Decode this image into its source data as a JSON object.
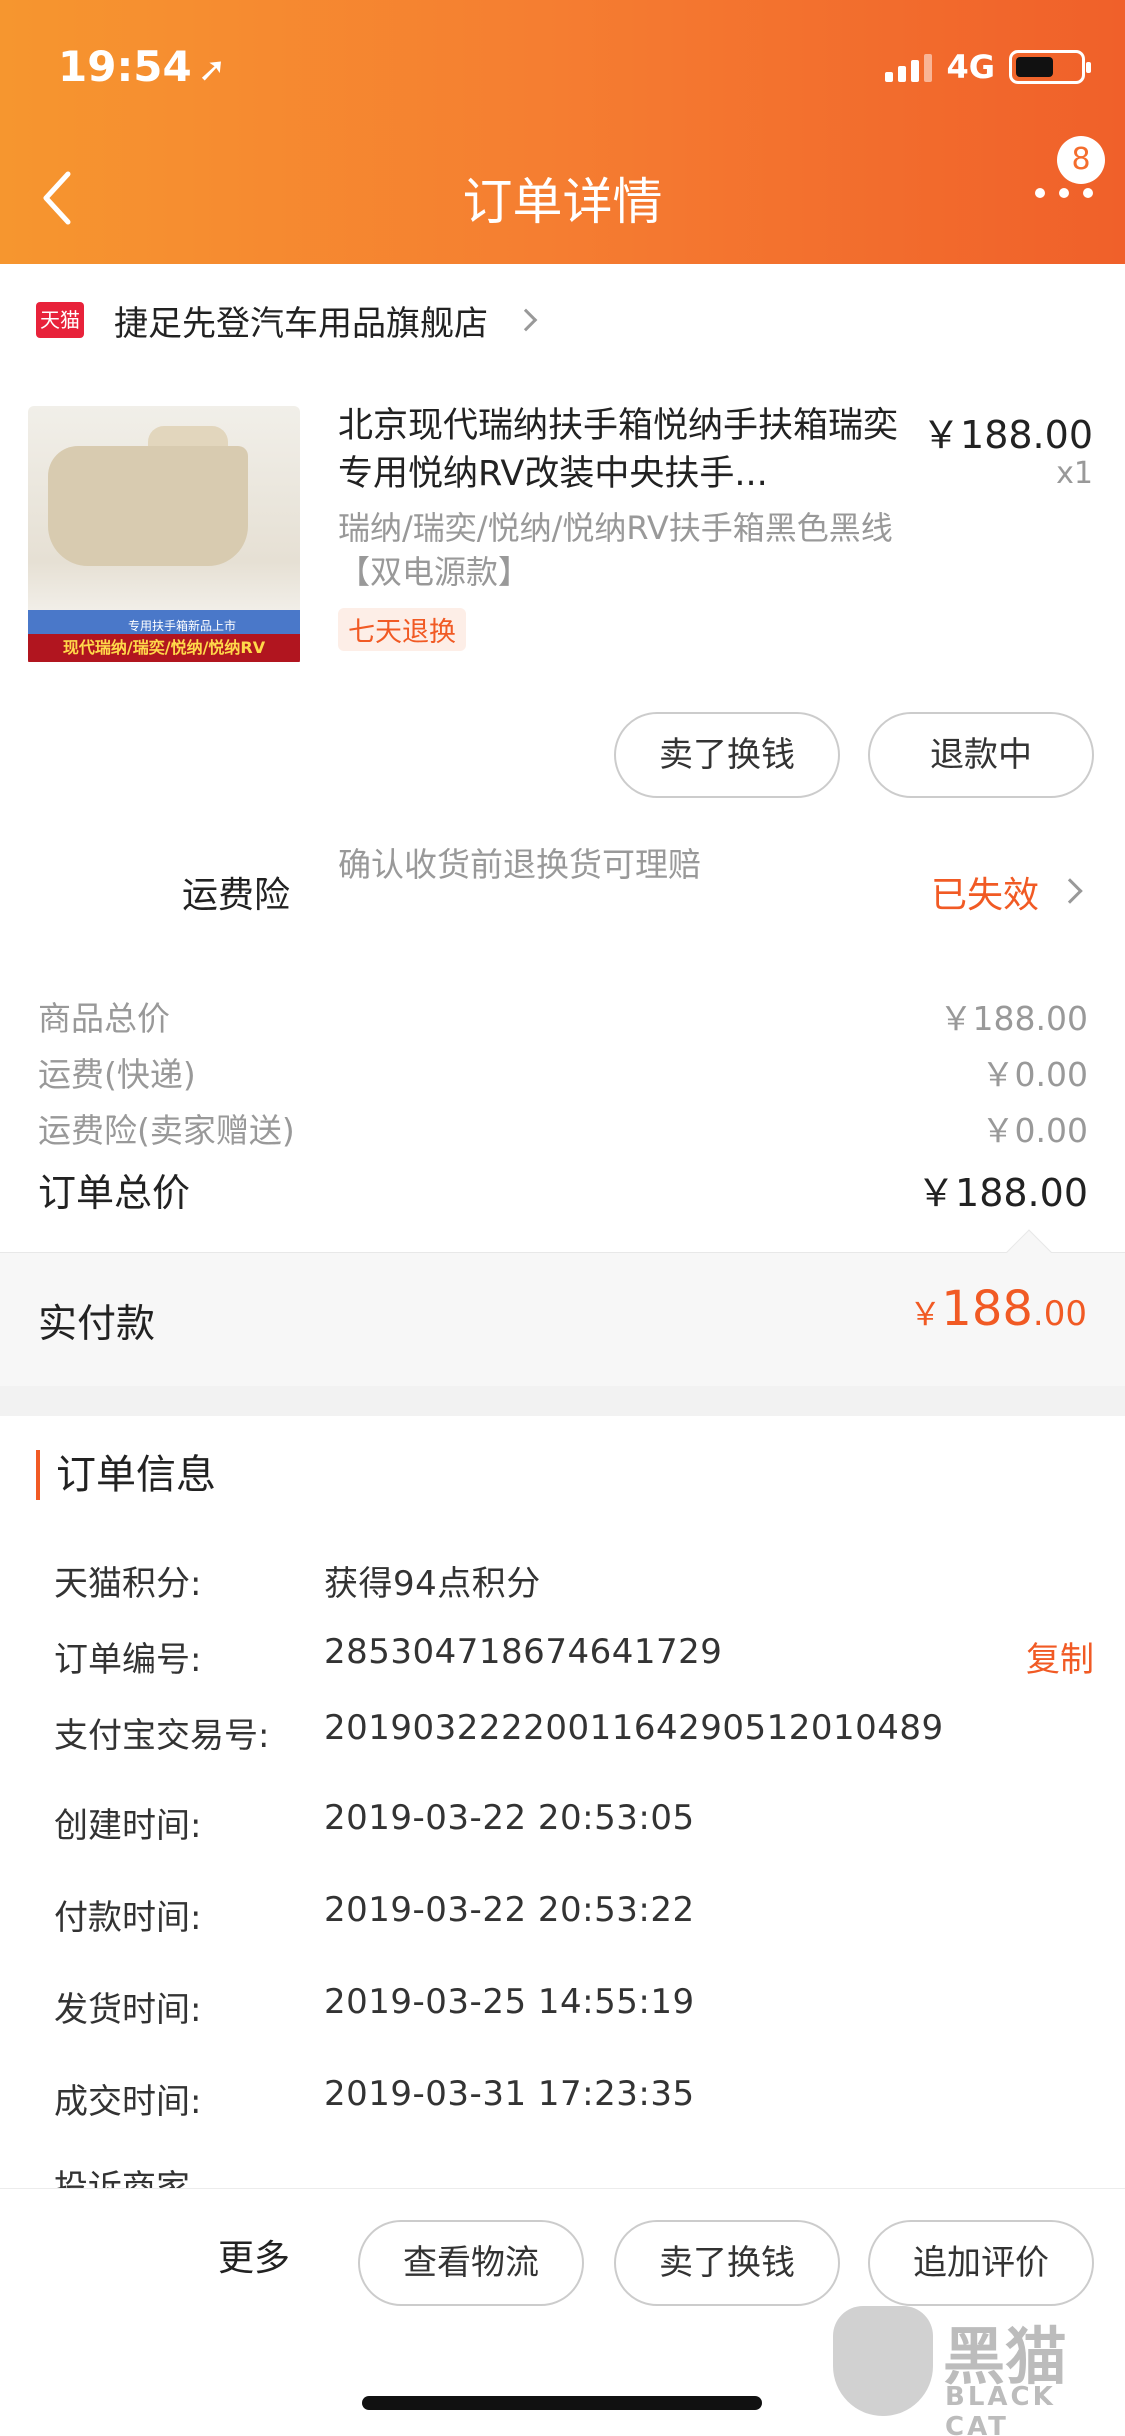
{
  "status_bar": {
    "time": "19:54",
    "network": "4G"
  },
  "nav": {
    "title": "订单详情",
    "badge_count": "8"
  },
  "store": {
    "logo_text": "天猫",
    "name": "捷足先登汽车用品旗舰店"
  },
  "product": {
    "title": "北京现代瑞纳扶手箱悦纳手扶箱瑞奕专用悦纳RV改装中央扶手...",
    "sku": "瑞纳/瑞奕/悦纳/悦纳RV扶手箱黑色黑线【双电源款】",
    "tag": "七天退换",
    "price": "￥188.00",
    "quantity": "x1",
    "image_promo_sub": "专用扶手箱新品上市",
    "image_promo_text": "现代瑞纳/瑞奕/悦纳/悦纳RV"
  },
  "order_actions": {
    "sell_label": "卖了换钱",
    "refund_label": "退款中"
  },
  "insurance": {
    "label": "运费险",
    "description": "确认收货前退换货可理赔",
    "status": "已失效"
  },
  "costs": {
    "items": [
      {
        "label": "商品总价",
        "value": "￥188.00"
      },
      {
        "label": "运费(快递)",
        "value": "￥0.00"
      },
      {
        "label": "运费险(卖家赠送)",
        "value": "￥0.00"
      }
    ],
    "total_label": "订单总价",
    "total_value": "￥188.00"
  },
  "paid": {
    "label": "实付款",
    "currency": "￥",
    "integer": "188",
    "decimal": ".00"
  },
  "order_info": {
    "title": "订单信息",
    "rows": [
      {
        "label": "天猫积分:",
        "value": "获得94点积分"
      },
      {
        "label": "订单编号:",
        "value": "285304718674641729",
        "action": "复制"
      },
      {
        "label": "支付宝交易号:",
        "value": "2019032222001164290512010489"
      },
      {
        "label": "创建时间:",
        "value": "2019-03-22 20:53:05"
      },
      {
        "label": "付款时间:",
        "value": "2019-03-22 20:53:22"
      },
      {
        "label": "发货时间:",
        "value": "2019-03-25 14:55:19"
      },
      {
        "label": "成交时间:",
        "value": "2019-03-31 17:23:35"
      }
    ],
    "partial_row_label": "投诉商家"
  },
  "footer": {
    "more_label": "更多",
    "buttons": [
      "查看物流",
      "卖了换钱",
      "追加评价"
    ]
  },
  "watermark": {
    "cn": "黑猫",
    "en": "BLACK CAT"
  },
  "colors": {
    "accent": "#f15a24",
    "header_start": "#f6962f",
    "header_end": "#f0602a"
  }
}
